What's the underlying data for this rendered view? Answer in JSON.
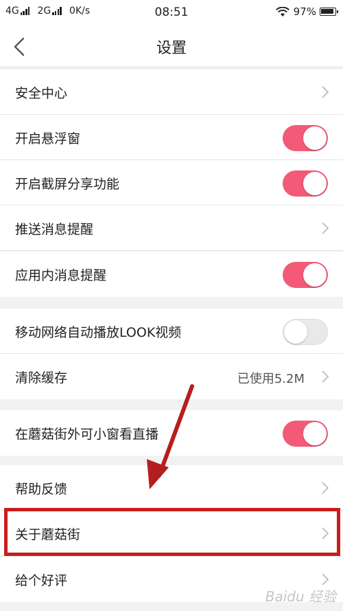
{
  "status_bar": {
    "network1": "4G",
    "network2": "2G",
    "speed": "0K/s",
    "time": "08:51",
    "battery": "97%"
  },
  "header": {
    "title": "设置",
    "back_icon": "back-chevron-icon"
  },
  "sections": [
    {
      "items": [
        {
          "label": "安全中心",
          "type": "link"
        },
        {
          "label": "开启悬浮窗",
          "type": "toggle",
          "on": true
        },
        {
          "label": "开启截屏分享功能",
          "type": "toggle",
          "on": true
        },
        {
          "label": "推送消息提醒",
          "type": "link"
        },
        {
          "label": "应用内消息提醒",
          "type": "toggle",
          "on": true
        }
      ]
    },
    {
      "items": [
        {
          "label": "移动网络自动播放LOOK视频",
          "type": "toggle",
          "on": false
        },
        {
          "label": "清除缓存",
          "type": "link",
          "value": "已使用5.2M"
        }
      ]
    },
    {
      "items": [
        {
          "label": "在蘑菇街外可小窗看直播",
          "type": "toggle",
          "on": true
        }
      ]
    },
    {
      "items": [
        {
          "label": "帮助反馈",
          "type": "link"
        },
        {
          "label": "关于蘑菇街",
          "type": "link"
        },
        {
          "label": "给个好评",
          "type": "link"
        }
      ]
    }
  ],
  "colors": {
    "toggle_on": "#f25a78",
    "toggle_off": "#e9e9e9",
    "annotation": "#c91d1d"
  },
  "watermark": "Baidu 经验"
}
